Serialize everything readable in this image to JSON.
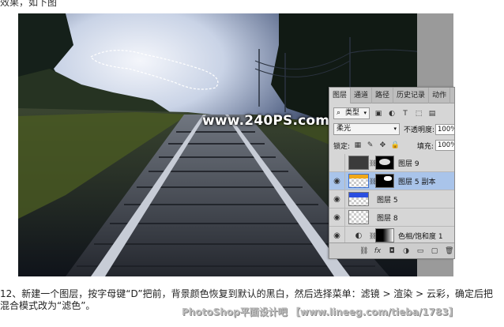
{
  "top_caption": "效果，如下图",
  "watermark_site": "www.240PS.com",
  "layers_panel": {
    "tabs": [
      "图层",
      "通道",
      "路径",
      "历史记录",
      "动作"
    ],
    "filter_type": "类型",
    "blend_mode": "柔光",
    "opacity_label": "不透明度:",
    "opacity_value": "100%",
    "lock_label": "锁定:",
    "fill_label": "填充:",
    "fill_value": "100%",
    "layers": [
      {
        "name": "图层 9",
        "visible": false,
        "selected": false
      },
      {
        "name": "图层 5 副本",
        "visible": true,
        "selected": true
      },
      {
        "name": "图层 5",
        "visible": true,
        "selected": false
      },
      {
        "name": "图层 8",
        "visible": true,
        "selected": false
      },
      {
        "name": "色相/饱和度 1",
        "visible": true,
        "selected": false
      }
    ],
    "bottom_icons": [
      "link-icon",
      "fx-icon",
      "mask-icon",
      "adjustment-icon",
      "folder-icon",
      "new-layer-icon",
      "trash-icon"
    ]
  },
  "step_text_line1": "12、新建一个图层，按字母键“D”把前，背景颜色恢复到默认的黑白，然后选择菜单：滤镜 > 渲染 > 云彩，确定后把",
  "step_text_line2": "混合模式改为“滤色”。",
  "footer_watermark": "PhotoShop平面设计吧 【www.lineeg.com/tieba/1783】"
}
